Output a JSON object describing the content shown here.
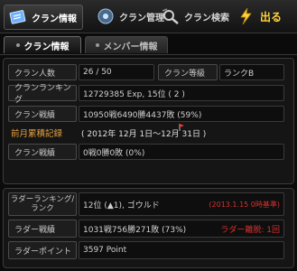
{
  "topbar": {
    "clan_info": "クラン情報",
    "clan_manage": "クラン管理",
    "clan_search": "クラン検索",
    "exit": "出る"
  },
  "subtabs": {
    "clan_info": "クラン情報",
    "member_info": "メンバー情報"
  },
  "info": {
    "members_label": "クラン人数",
    "members_value": "26 / 50",
    "rank_label": "クラン等級",
    "rank_value": "ランクB",
    "ranking_label": "クランランキング",
    "ranking_value": "12729385 Exp, 15位 ( 2 )",
    "record_label": "クラン戦績",
    "record_value": "10950戦6490勝4437敗 (59%)",
    "last_month_label": "前月累積記録",
    "last_month_value": "( 2012年 12月 1日〜12月 31日 )",
    "monthly_record_label": "クラン戦績",
    "monthly_record_value": "0戦0勝0敗 (0%)"
  },
  "ladder": {
    "rank_label": "ラダーランキング/ランク",
    "rank_value": "12位 (▲1), ゴウルド",
    "rank_note": "(2013.1.15 0時基準)",
    "record_label": "ラダー戦績",
    "record_value": "1031戦756勝271敗 (73%)",
    "escape_note": "ラダー離脱: 1回",
    "points_label": "ラダーポイント",
    "points_value": "3597 Point"
  }
}
